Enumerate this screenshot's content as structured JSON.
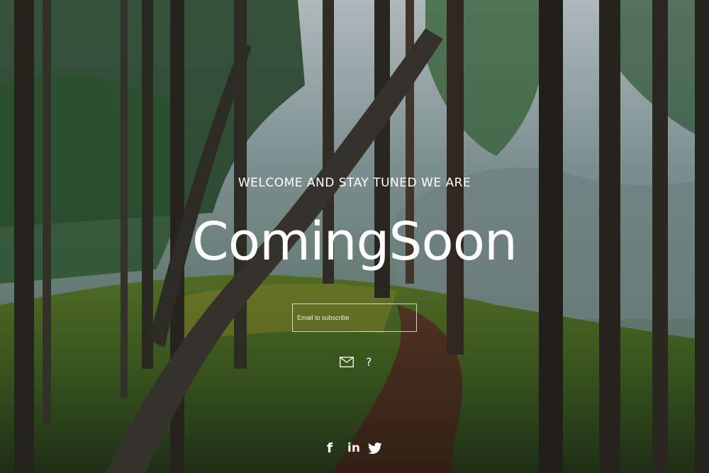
{
  "hero": {
    "welcome_text": "WELCOME AND STAY TUNED WE ARE",
    "headline": "ComingSoon"
  },
  "subscribe": {
    "placeholder": "Email to subscribe",
    "value": ""
  },
  "actions": {
    "mail_icon": "envelope-icon",
    "help_label": "?"
  },
  "social": {
    "facebook_label": "f",
    "linkedin_label": "in",
    "twitter_icon": "twitter-bird-icon"
  }
}
